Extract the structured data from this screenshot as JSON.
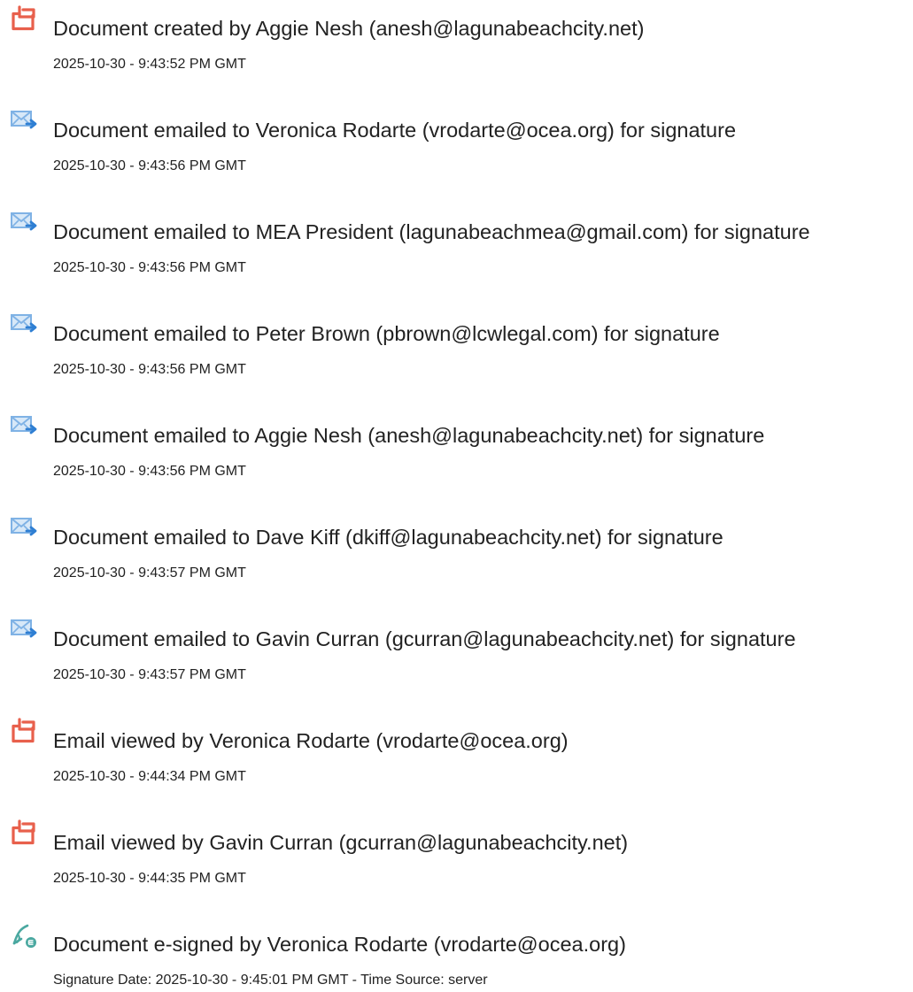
{
  "events": [
    {
      "icon": "document-icon",
      "title": "Document created by Aggie Nesh (anesh@lagunabeachcity.net)",
      "time": "2025-10-30 - 9:43:52 PM GMT"
    },
    {
      "icon": "email-sent-icon",
      "title": "Document emailed to Veronica Rodarte (vrodarte@ocea.org) for signature",
      "time": "2025-10-30 - 9:43:56 PM GMT"
    },
    {
      "icon": "email-sent-icon",
      "title": "Document emailed to MEA President (lagunabeachmea@gmail.com) for signature",
      "time": "2025-10-30 - 9:43:56 PM GMT"
    },
    {
      "icon": "email-sent-icon",
      "title": "Document emailed to Peter Brown (pbrown@lcwlegal.com) for signature",
      "time": "2025-10-30 - 9:43:56 PM GMT"
    },
    {
      "icon": "email-sent-icon",
      "title": "Document emailed to Aggie Nesh (anesh@lagunabeachcity.net) for signature",
      "time": "2025-10-30 - 9:43:56 PM GMT"
    },
    {
      "icon": "email-sent-icon",
      "title": "Document emailed to Dave Kiff (dkiff@lagunabeachcity.net) for signature",
      "time": "2025-10-30 - 9:43:57 PM GMT"
    },
    {
      "icon": "email-sent-icon",
      "title": "Document emailed to Gavin Curran (gcurran@lagunabeachcity.net) for signature",
      "time": "2025-10-30 - 9:43:57 PM GMT"
    },
    {
      "icon": "document-icon",
      "title": "Email viewed by Veronica Rodarte (vrodarte@ocea.org)",
      "time": "2025-10-30 - 9:44:34 PM GMT"
    },
    {
      "icon": "document-icon",
      "title": "Email viewed by Gavin Curran (gcurran@lagunabeachcity.net)",
      "time": "2025-10-30 - 9:44:35 PM GMT"
    },
    {
      "icon": "esign-pen-icon",
      "title": "Document e-signed by Veronica Rodarte (vrodarte@ocea.org)",
      "time": "Signature Date: 2025-10-30 - 9:45:01 PM GMT - Time Source: server"
    }
  ],
  "colors": {
    "text": "#222222",
    "document_icon": "#e8604c",
    "email_icon": "#7fb2e5",
    "email_arrow": "#2f7fd3",
    "esign_icon": "#4aa8a0"
  }
}
